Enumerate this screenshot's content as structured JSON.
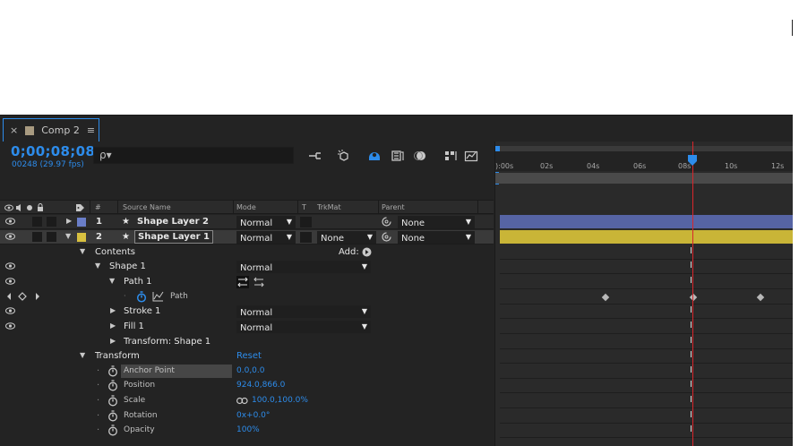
{
  "tab": {
    "close": "×",
    "title": "Comp 2",
    "menu": "≡"
  },
  "timecode": "0;00;08;08",
  "frames": "00248 (29.97 fps)",
  "search": {
    "placeholder": "ρ▾"
  },
  "columns": {
    "hash": "#",
    "source": "Source Name",
    "mode": "Mode",
    "t": "T",
    "trkmat": "TrkMat",
    "parent": "Parent"
  },
  "layers": [
    {
      "num": "1",
      "name": "Shape Layer 2",
      "mode": "Normal",
      "trkmat": "",
      "parent": "None",
      "color": "#6a7ec8",
      "bar_color": "#5664a4"
    },
    {
      "num": "2",
      "name": "Shape Layer 1",
      "mode": "Normal",
      "trkmat": "None",
      "parent": "None",
      "color": "#d8c040",
      "bar_color": "#c9b537"
    }
  ],
  "props": {
    "contents": "Contents",
    "add": "Add:",
    "shape1": "Shape 1",
    "shape1_mode": "Normal",
    "path1": "Path 1",
    "path": "Path",
    "stroke1": "Stroke 1",
    "stroke1_mode": "Normal",
    "fill1": "Fill 1",
    "fill1_mode": "Normal",
    "transform_shape": "Transform: Shape 1",
    "transform": "Transform",
    "reset": "Reset",
    "anchor": "Anchor Point",
    "anchor_val": "0.0,0.0",
    "position": "Position",
    "position_val": "924.0,866.0",
    "scale": "Scale",
    "scale_val": "100.0,100.0%",
    "rotation": "Rotation",
    "rotation_val": "0x+0.0°",
    "opacity": "Opacity",
    "opacity_val": "100%"
  },
  "ruler": {
    "ticks": [
      "):00s",
      "02s",
      "04s",
      "06s",
      "08s",
      "10s",
      "12s"
    ]
  },
  "colors": {
    "accent": "#2d8ceb",
    "playhead": "#d9262b"
  }
}
